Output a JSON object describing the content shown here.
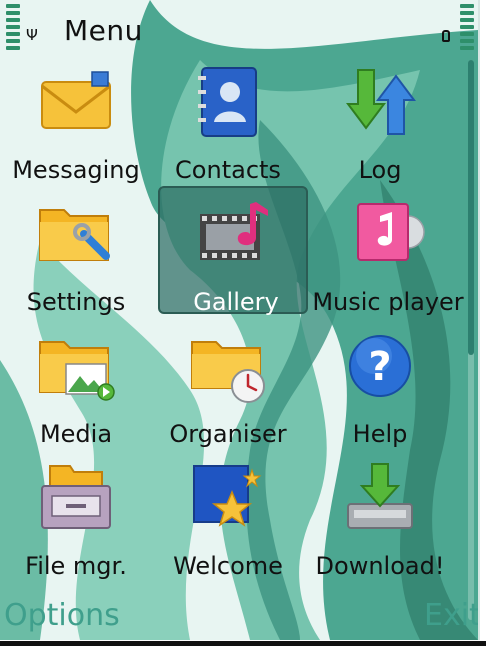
{
  "header": {
    "title": "Menu"
  },
  "icons": {
    "signal": "antenna-icon",
    "lock": "keylock-icon"
  },
  "grid": [
    {
      "label": "Messaging",
      "icon": "envelope-icon",
      "selected": false
    },
    {
      "label": "Contacts",
      "icon": "contacts-book-icon",
      "selected": false
    },
    {
      "label": "Log",
      "icon": "log-arrows-icon",
      "selected": false
    },
    {
      "label": "Settings",
      "icon": "settings-folder-wrench-icon",
      "selected": false
    },
    {
      "label": "Gallery",
      "icon": "gallery-film-music-icon",
      "selected": true
    },
    {
      "label": "Music player",
      "icon": "music-player-icon",
      "selected": false
    },
    {
      "label": "Media",
      "icon": "media-folder-icon",
      "selected": false
    },
    {
      "label": "Organiser",
      "icon": "organiser-folder-clock-icon",
      "selected": false
    },
    {
      "label": "Help",
      "icon": "help-question-icon",
      "selected": false
    },
    {
      "label": "File mgr.",
      "icon": "file-manager-drawer-icon",
      "selected": false
    },
    {
      "label": "Welcome",
      "icon": "welcome-stars-icon",
      "selected": false
    },
    {
      "label": "Download!",
      "icon": "download-arrow-icon",
      "selected": false
    }
  ],
  "softkeys": {
    "left": "Options",
    "right": "Exit"
  },
  "colors": {
    "accent": "#3f9f8c",
    "selection": "#2d6e64",
    "background": "#eaf6f4",
    "wave_dark": "#2f7c6a",
    "wave_mid": "#6dbfa9"
  }
}
